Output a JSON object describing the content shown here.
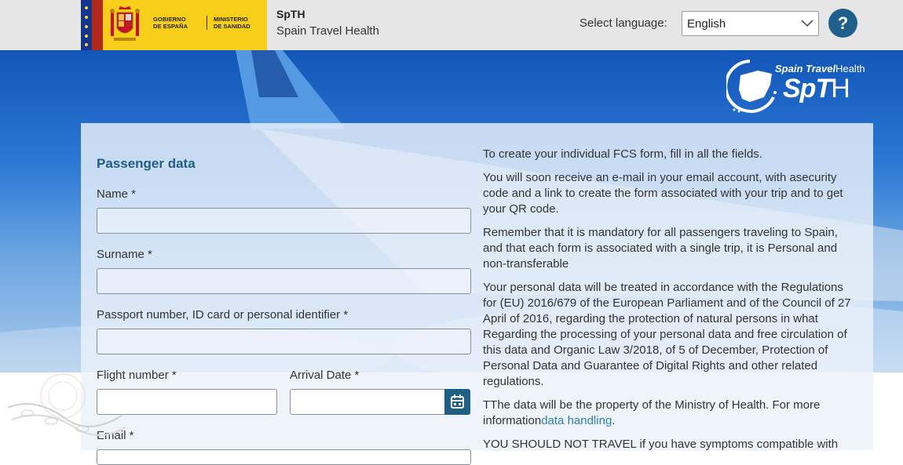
{
  "header": {
    "gov_line1": "GOBIERNO",
    "gov_line2": "DE ESPAÑA",
    "min_line1": "MINISTERIO",
    "min_line2": "DE SANIDAD",
    "app_short": "SpTH",
    "app_long": "Spain Travel Health",
    "lang_label": "Select language:",
    "lang_value": "English",
    "help_label": "?"
  },
  "brand": {
    "top_bold": "Spain Travel",
    "top_light": "Health",
    "main_bold": "SpT",
    "main_light": "H"
  },
  "form": {
    "title": "Passenger data",
    "name_label": "Name *",
    "surname_label": "Surname *",
    "passport_label": "Passport number, ID card or personal identifier *",
    "flight_label": "Flight number *",
    "arrival_label": "Arrival Date *",
    "email_label": "Email *",
    "name_value": "",
    "surname_value": "",
    "passport_value": "",
    "flight_value": "",
    "arrival_value": ""
  },
  "info": {
    "p1": "To create your individual FCS form, fill in all the fields.",
    "p2": "You will soon receive an e-mail in your email account, with asecurity code and a link to create the form associated with your trip and to get your QR code.",
    "p3": "Remember that it is mandatory for all passengers traveling to Spain, and that each form is associated with a single trip, it is Personal and non-transferable",
    "p4": "Your personal data will be treated in accordance with the Regulations for (EU) 2016/679 of the European Parliament and of the Council of 27 April of 2016, regarding the protection of natural persons in what Regarding the processing of your personal data and free circulation of this data and Organic Law 3/2018, of 5 of December, Protection of Personal Data and Guarantee of Digital Rights and other related regulations.",
    "p5_text": "TThe data will be the property of the Ministry of Health. For more information",
    "p5_link": "data handling",
    "p5_end": ".",
    "p6": "YOU SHOULD NOT TRAVEL if you have symptoms compatible with"
  },
  "colors": {
    "accent": "#1d5f85",
    "link": "#2a7fb5",
    "gov_yellow": "#f7ce1a"
  },
  "icons": [
    "crest-icon",
    "chevron-down-icon",
    "help-icon",
    "calendar-icon",
    "spain-map-icon",
    "watermark-icon"
  ]
}
